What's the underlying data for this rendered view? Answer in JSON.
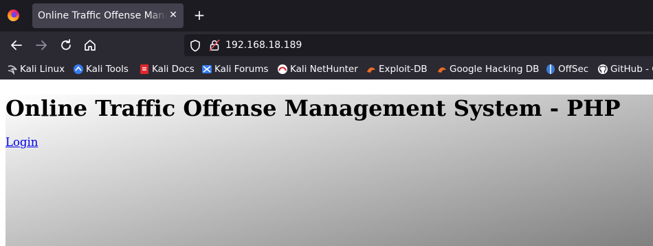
{
  "browser": {
    "tab_title": "Online Traffic Offense Management System - PHP",
    "tab_close": "✕",
    "new_tab": "+",
    "url": "192.168.18.189"
  },
  "bookmarks": [
    {
      "label": "Kali Linux",
      "icon": "kali-dragon-icon"
    },
    {
      "label": "Kali Tools",
      "icon": "kali-tools-icon"
    },
    {
      "label": "Kali Docs",
      "icon": "kali-docs-icon"
    },
    {
      "label": "Kali Forums",
      "icon": "kali-forums-icon"
    },
    {
      "label": "Kali NetHunter",
      "icon": "kali-nethunter-icon"
    },
    {
      "label": "Exploit-DB",
      "icon": "exploit-db-icon"
    },
    {
      "label": "Google Hacking DB",
      "icon": "ghdb-icon"
    },
    {
      "label": "OffSec",
      "icon": "offsec-icon"
    },
    {
      "label": "GitHub - G",
      "icon": "github-icon"
    }
  ],
  "page": {
    "heading": "Online Traffic Offense Management System - PHP",
    "login_link": "Login"
  },
  "colors": {
    "tab_bar": "#1c1b22",
    "toolbar": "#2b2a33",
    "link": "#0000ee",
    "gradient_start": "#ffffff",
    "gradient_end": "#808080"
  }
}
